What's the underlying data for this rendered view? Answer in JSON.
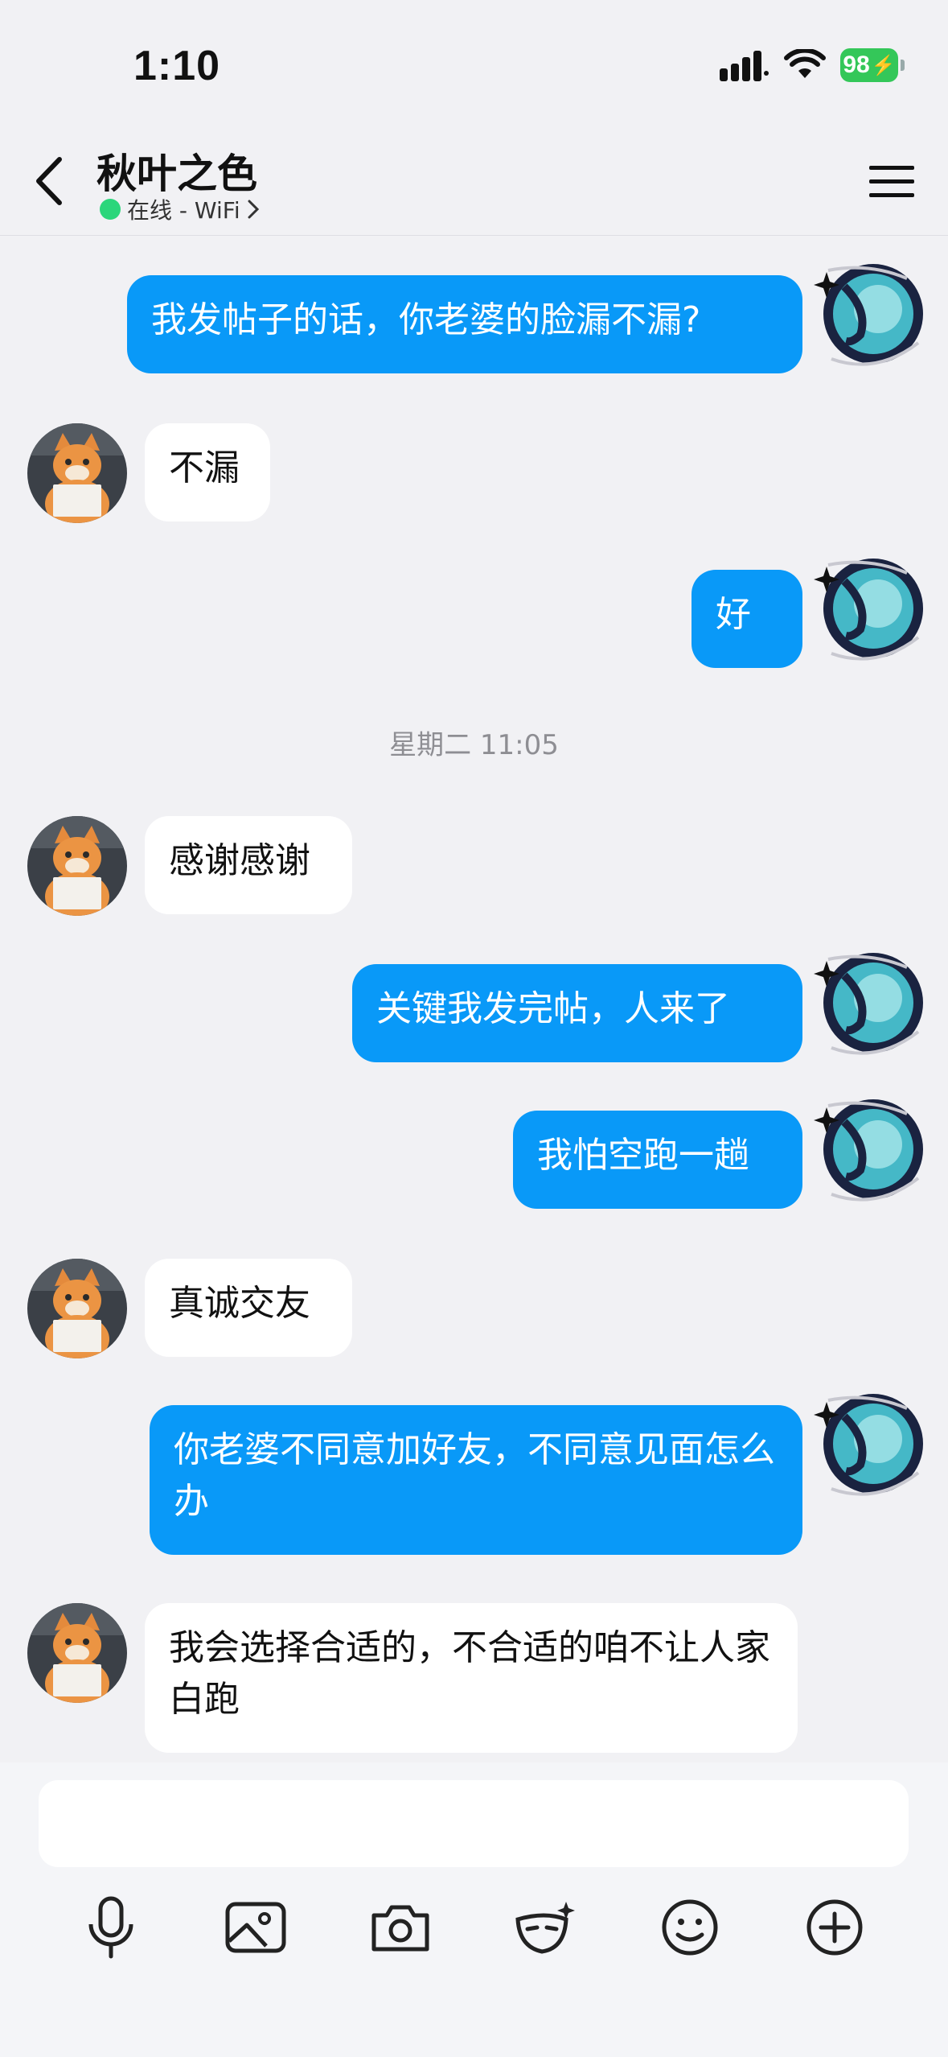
{
  "status_bar": {
    "time": "1:10",
    "battery": "98"
  },
  "header": {
    "contact_name": "秋叶之色",
    "presence": "在线 - WiFi",
    "presence_color": "#2bd67b"
  },
  "timestamp": "星期二 11:05",
  "messages": [
    {
      "side": "out",
      "text": "我发帖子的话，你老婆的脸漏不漏?"
    },
    {
      "side": "in",
      "text": "不漏"
    },
    {
      "side": "out",
      "text": "好"
    },
    {
      "side": "in",
      "text": "感谢感谢"
    },
    {
      "side": "out",
      "text": "关键我发完帖，人来了"
    },
    {
      "side": "out",
      "text": "我怕空跑一趟"
    },
    {
      "side": "in",
      "text": "真诚交友"
    },
    {
      "side": "out",
      "text": "你老婆不同意加好友，不同意见面怎么办"
    },
    {
      "side": "in",
      "text": "我会选择合适的，不合适的咱不让人家白跑"
    }
  ],
  "composer": {
    "input_value": "",
    "tools": [
      "mic-icon",
      "image-icon",
      "camera-icon",
      "mask-icon",
      "emoji-icon",
      "plus-icon"
    ]
  },
  "colors": {
    "outgoing_bubble": "#0999f8",
    "incoming_bubble": "#ffffff",
    "background": "#f1f1f4"
  }
}
